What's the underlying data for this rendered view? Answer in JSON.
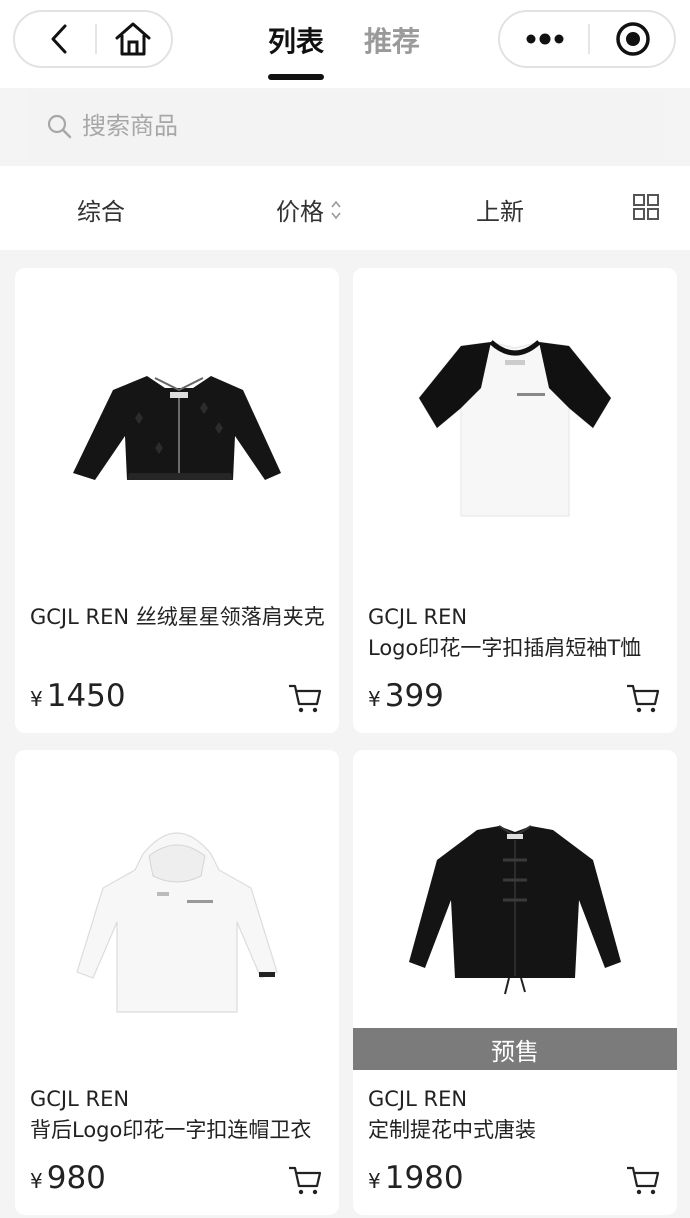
{
  "nav": {
    "back_icon": "chevron-left-icon",
    "home_icon": "home-icon",
    "more_icon": "more-dots-icon",
    "close_icon": "target-circle-icon"
  },
  "tabs": [
    {
      "label": "列表",
      "active": true
    },
    {
      "label": "推荐",
      "active": false
    }
  ],
  "search": {
    "placeholder": "搜索商品"
  },
  "sort": {
    "items": [
      {
        "label": "综合"
      },
      {
        "label": "价格"
      },
      {
        "label": "上新"
      }
    ],
    "layout_icon": "grid-layout-icon"
  },
  "products": [
    {
      "name": "GCJL REN 丝绒星星领落肩夹克",
      "currency": "¥",
      "price": "1450",
      "badge": ""
    },
    {
      "name_line1": "GCJL REN",
      "name_line2": "Logo印花一字扣插肩短袖T恤",
      "currency": "¥",
      "price": "399",
      "badge": ""
    },
    {
      "name_line1": "GCJL REN",
      "name_line2": "背后Logo印花一字扣连帽卫衣",
      "currency": "¥",
      "price": "980",
      "badge": ""
    },
    {
      "name_line1": "GCJL REN",
      "name_line2": "定制提花中式唐装",
      "currency": "¥",
      "price": "1980",
      "badge": "预售"
    }
  ],
  "colors": {
    "accent": "#111111",
    "muted": "#9a9a9a",
    "presale_bg": "#7b7b7b"
  }
}
